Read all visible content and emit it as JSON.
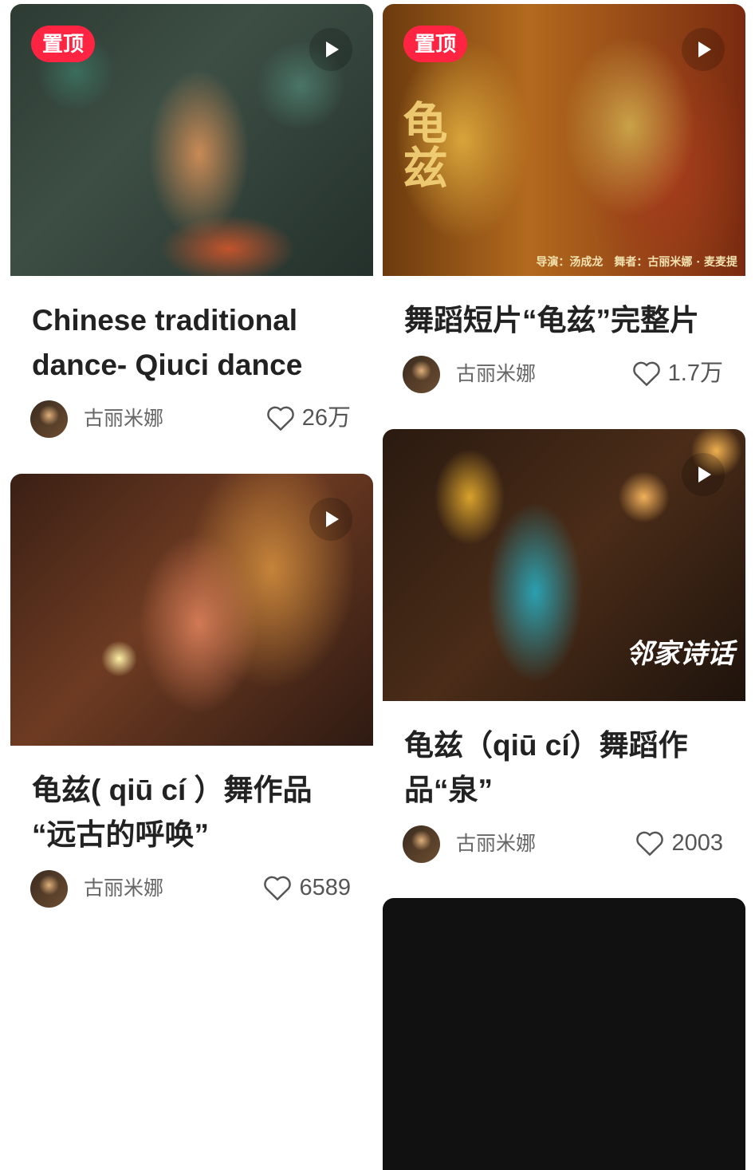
{
  "feed": {
    "cards": [
      {
        "pinned_label": "置顶",
        "title_lines": [
          "Chinese traditional",
          "dance- Qiuci dance"
        ],
        "author": "古丽米娜",
        "likes": "26万"
      },
      {
        "pinned_label": "置顶",
        "overlay_credits": "导演：汤成龙　舞者：古丽米娜 · 麦麦提",
        "overlay_title": "龟兹",
        "title_lines": [
          "舞蹈短片“龟兹”完整片"
        ],
        "author": "古丽米娜",
        "likes": "1.7万"
      },
      {
        "title_lines": [
          "龟兹( qiū cí ）舞作品",
          "“远古的呼唤”"
        ],
        "author": "古丽米娜",
        "likes": "6589"
      },
      {
        "overlay_logo": "邻家诗话",
        "title_lines": [
          "龟兹（qiū cí）舞蹈作",
          "品“泉”"
        ],
        "author": "古丽米娜",
        "likes": "2003"
      }
    ]
  }
}
